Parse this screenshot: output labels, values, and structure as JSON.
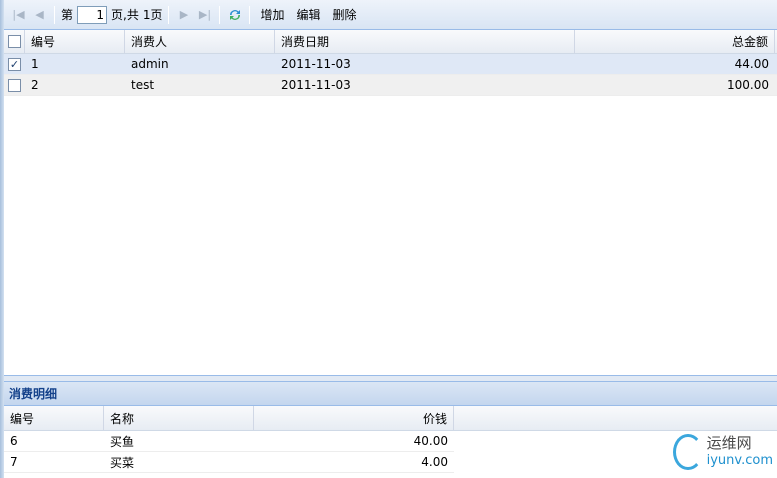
{
  "toolbar": {
    "page_prefix": "第",
    "page_value": "1",
    "page_suffix": "页,共",
    "total_pages": "1页",
    "add_label": "增加",
    "edit_label": "编辑",
    "delete_label": "删除"
  },
  "master_grid": {
    "columns": [
      "编号",
      "消费人",
      "消费日期",
      "总金额"
    ],
    "rows": [
      {
        "id": "1",
        "person": "admin",
        "date": "2011-11-03",
        "total": "44.00",
        "checked": true
      },
      {
        "id": "2",
        "person": "test",
        "date": "2011-11-03",
        "total": "100.00",
        "checked": false
      }
    ]
  },
  "detail": {
    "title": "消费明细",
    "columns": [
      "编号",
      "名称",
      "价钱"
    ],
    "rows": [
      {
        "id": "6",
        "name": "买鱼",
        "price": "40.00"
      },
      {
        "id": "7",
        "name": "买菜",
        "price": "4.00"
      }
    ]
  },
  "watermark": {
    "cn": "运维网",
    "en": "iyunv.com"
  },
  "colors": {
    "accent": "#15428b",
    "selected_row": "#dfe8f6",
    "border": "#99bbe8"
  }
}
